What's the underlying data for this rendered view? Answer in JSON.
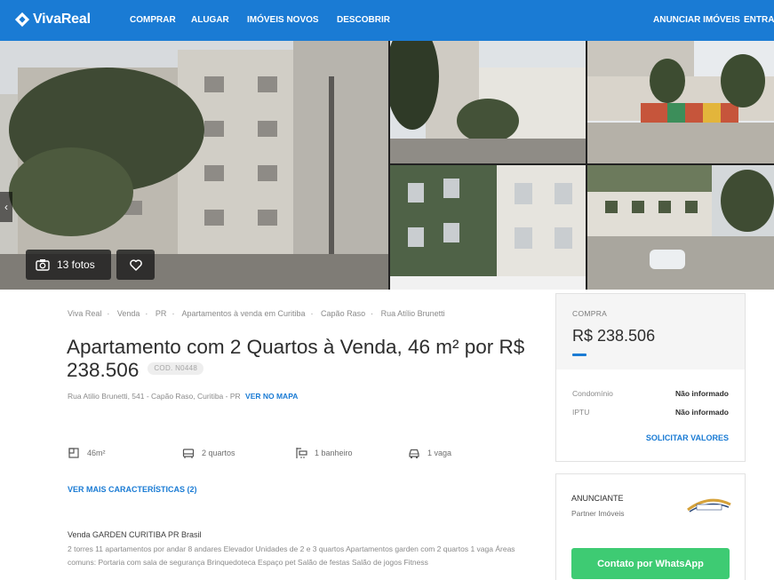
{
  "header": {
    "logo_text": "VivaReal",
    "nav": [
      "COMPRAR",
      "ALUGAR",
      "IMÓVEIS NOVOS",
      "DESCOBRIR"
    ],
    "right_nav": [
      "ANUNCIAR IMÓVEIS",
      "ENTRAR"
    ]
  },
  "gallery": {
    "photos_label": "13 fotos"
  },
  "breadcrumb": [
    "Viva Real",
    "Venda",
    "PR",
    "Apartamentos à venda em Curitiba",
    "Capão Raso",
    "Rua Atílio Brunetti"
  ],
  "listing": {
    "title": "Apartamento com 2 Quartos à Venda, 46 m² por R$ 238.506",
    "code": "COD. N0448",
    "address": "Rua Atilio Brunetti, 541 - Capão Raso, Curitiba - PR",
    "map_link": "VER NO MAPA"
  },
  "features": [
    {
      "icon": "area-icon",
      "label": "46m²"
    },
    {
      "icon": "bed-icon",
      "label": "2 quartos"
    },
    {
      "icon": "bath-icon",
      "label": "1 banheiro"
    },
    {
      "icon": "car-icon",
      "label": "1 vaga"
    }
  ],
  "more_link": "VER MAIS CARACTERÍSTICAS (2)",
  "description": {
    "title": "Venda GARDEN CURITIBA PR Brasil",
    "text": "2 torres 11 apartamentos por andar 8 andares Elevador Unidades de 2 e 3 quartos Apartamentos garden com 2 quartos 1 vaga Áreas comuns: Portaria com sala de segurança Brinquedoteca Espaço pet Salão de festas Salão de jogos Fitness"
  },
  "price_card": {
    "label": "COMPRA",
    "price": "R$ 238.506",
    "fees": [
      {
        "label": "Condomínio",
        "value": "Não informado"
      },
      {
        "label": "IPTU",
        "value": "Não informado"
      }
    ],
    "request_link": "SOLICITAR VALORES"
  },
  "advertiser": {
    "label": "ANUNCIANTE",
    "name": "Partner Imóveis",
    "whatsapp_button": "Contato por WhatsApp"
  },
  "colors": {
    "brand": "#1a7bd4",
    "whatsapp": "#3ecb73"
  }
}
